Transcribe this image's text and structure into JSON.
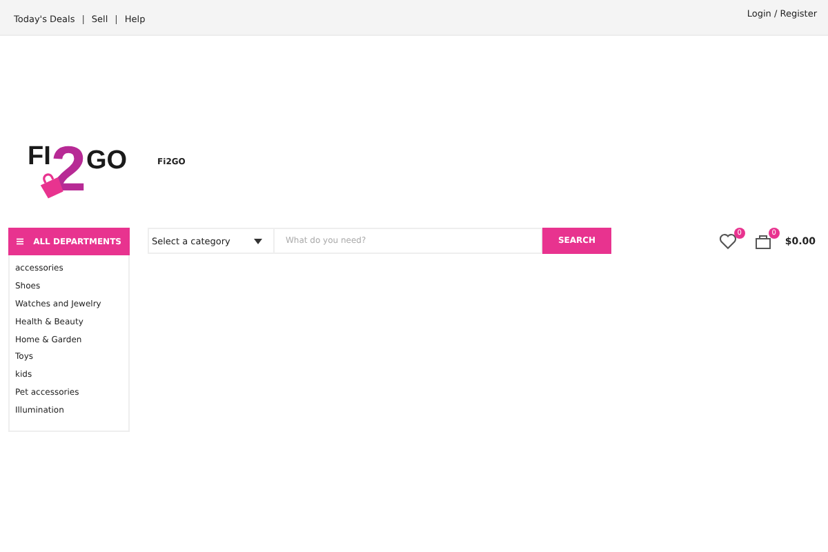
{
  "top_bar": {
    "links": [
      "Today's Deals",
      "Sell",
      "Help"
    ],
    "separator": "|",
    "account": "Login / Register"
  },
  "logo": {
    "left": "FI",
    "middle": "2",
    "right": "GO"
  },
  "site_name": "Fi2GO",
  "departments": {
    "title": "ALL DEPARTMENTS",
    "items": [
      "accessories",
      "Shoes",
      "Watches and Jewelry",
      "Health & Beauty",
      "Home & Garden",
      "Toys",
      "kids",
      "Pet accessories",
      "Illumination"
    ]
  },
  "search": {
    "category": "Select a category",
    "placeholder": "What do you need?",
    "button": "SEARCH"
  },
  "wishlist": {
    "count": "0"
  },
  "cart": {
    "count": "0",
    "total": "$0.00"
  }
}
